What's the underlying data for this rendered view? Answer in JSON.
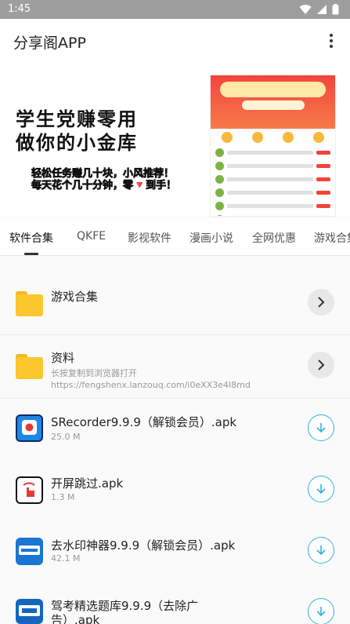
{
  "status_bar": {
    "time": "1:45"
  },
  "app_bar": {
    "title": "分享阁APP"
  },
  "banner": {
    "headline_line1": "学生党赚零用",
    "headline_line2": "做你的小金库",
    "sub_line1": "轻松任务赚几十块，小风推荐！",
    "sub_line2": "每天花个几十分钟，零🔻到手！"
  },
  "tabs": [
    "软件合集",
    "QKFE",
    "影视软件",
    "漫画小说",
    "全网优惠",
    "游戏合集"
  ],
  "items": [
    {
      "type": "folder",
      "title": "游戏合集"
    },
    {
      "type": "folder",
      "title": "资料",
      "subtitle": "长按复制到浏览器打开",
      "subtitle2": "https://fengshenx.lanzouq.com/i0eXX3e4l8md"
    },
    {
      "type": "file",
      "title": "SRecorder9.9.9（解锁会员）.apk",
      "size": "25.0 M"
    },
    {
      "type": "file",
      "title": "开屏跳过.apk",
      "size": "1.3 M"
    },
    {
      "type": "file",
      "title": "去水印神器9.9.9（解锁会员）.apk",
      "size": "42.1 M"
    },
    {
      "type": "file",
      "title_line1": "驾考精选题库9.9.9（去除广",
      "title_line2": "告）.apk"
    }
  ],
  "colors": {
    "accent": "#34b1e4",
    "folder": "#fbc72e",
    "status_bar": "#9e9e9e"
  },
  "icons": {
    "status": [
      "wifi-icon",
      "signal-icon",
      "battery-icon"
    ],
    "menu": "more-vert-icon",
    "folder": "folder-icon",
    "open": "chevron-right-icon",
    "download": "download-icon"
  }
}
